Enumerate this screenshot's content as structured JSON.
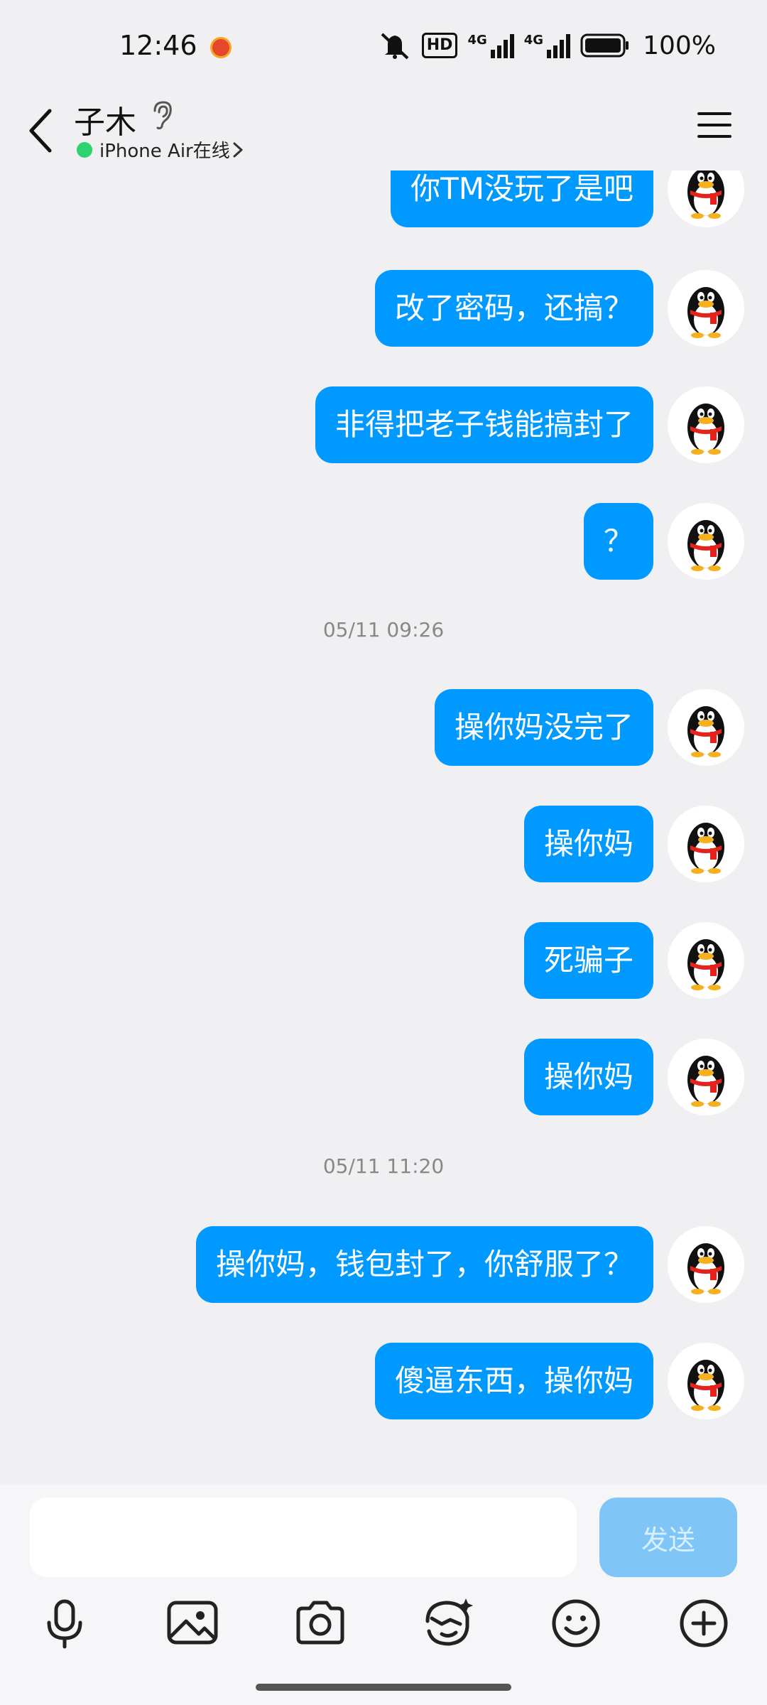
{
  "status_bar": {
    "time": "12:46",
    "battery": "100%",
    "network_labels": [
      "HD",
      "4G",
      "4G"
    ]
  },
  "header": {
    "name": "子木",
    "online_status": "iPhone Air在线"
  },
  "messages": [
    {
      "text": "你TM没玩了是吧"
    },
    {
      "text": "改了密码，还搞？"
    },
    {
      "text": "非得把老子钱能搞封了"
    },
    {
      "text": "？"
    },
    {
      "timestamp": "05/11 09:26"
    },
    {
      "text": "操你妈没完了"
    },
    {
      "text": "操你妈"
    },
    {
      "text": "死骗子"
    },
    {
      "text": "操你妈"
    },
    {
      "timestamp": "05/11 11:20"
    },
    {
      "text": "操你妈，钱包封了，你舒服了？"
    },
    {
      "text": "傻逼东西，操你妈"
    }
  ],
  "input": {
    "placeholder": "",
    "send_label": "发送"
  },
  "toolbar": [
    "microphone-icon",
    "image-icon",
    "camera-icon",
    "sticker-icon",
    "emoji-icon",
    "plus-icon"
  ],
  "colors": {
    "bubble": "#0099ff",
    "background": "#f0f0f2",
    "send_disabled": "#7fc6f7",
    "online": "#2dd36f"
  }
}
